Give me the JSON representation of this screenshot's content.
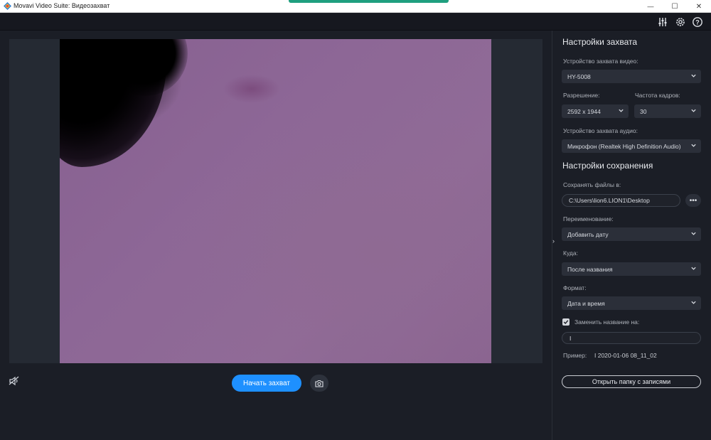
{
  "window": {
    "title": "Movavi Video Suite: Видеозахват",
    "minimize": "—",
    "maximize": "☐",
    "close": "✕"
  },
  "toolbar": {
    "icons": [
      "equalizer-icon",
      "gear-icon",
      "help-icon"
    ]
  },
  "preview": {
    "start_button": "Начать захват",
    "snapshot_icon": "camera-icon",
    "mute_icon": "speaker-muted-icon"
  },
  "panel": {
    "capture_settings_title": "Настройки захвата",
    "video_device_label": "Устройство захвата видео:",
    "video_device_value": "HY-5008",
    "resolution_label": "Разрешение:",
    "resolution_value": "2592 x 1944",
    "fps_label": "Частота кадров:",
    "fps_value": "30",
    "audio_device_label": "Устройство захвата аудио:",
    "audio_device_value": "Микрофон (Realtek High Definition Audio)",
    "save_settings_title": "Настройки сохранения",
    "save_to_label": "Сохранять файлы в:",
    "save_to_value": "C:\\Users\\lion6.LION1\\Desktop",
    "more_button": "•••",
    "rename_label": "Переименование:",
    "rename_value": "Добавить дату",
    "where_label": "Куда:",
    "where_value": "После названия",
    "format_label": "Формат:",
    "format_value": "Дата и время",
    "replace_name_label": "Заменить название на:",
    "replace_name_checked": true,
    "replace_name_value": "I",
    "example_label": "Пример:",
    "example_value": "I 2020-01-06 08_11_02",
    "open_folder_button": "Открыть папку с записями"
  },
  "colors": {
    "accent_blue": "#1e90ff",
    "background": "#1b1e26",
    "field": "#2b2f39",
    "title_accent": "#1f9f7f"
  }
}
